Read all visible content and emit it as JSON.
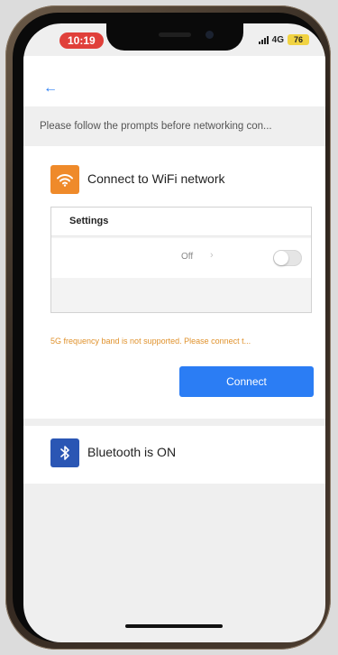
{
  "status_bar": {
    "time": "10:19",
    "network": "4G",
    "battery": "76"
  },
  "header": {
    "back_icon": "arrow-left-icon",
    "prompt_text": "Please follow the prompts before networking con..."
  },
  "wifi_section": {
    "icon": "wifi-icon",
    "title": "Connect to WiFi network",
    "settings": {
      "title": "Settings",
      "wifi_status": "Off",
      "wifi_toggle_on": false
    },
    "warning": "5G frequency band is not supported. Please connect t...",
    "connect_label": "Connect"
  },
  "bluetooth_section": {
    "icon": "bluetooth-icon",
    "title": "Bluetooth is ON"
  },
  "colors": {
    "accent": "#2b7df4",
    "wifi_tile": "#ef8a2a",
    "bluetooth_tile": "#2a56b4",
    "warning": "#e0922d",
    "time_pill": "#e0403a"
  }
}
